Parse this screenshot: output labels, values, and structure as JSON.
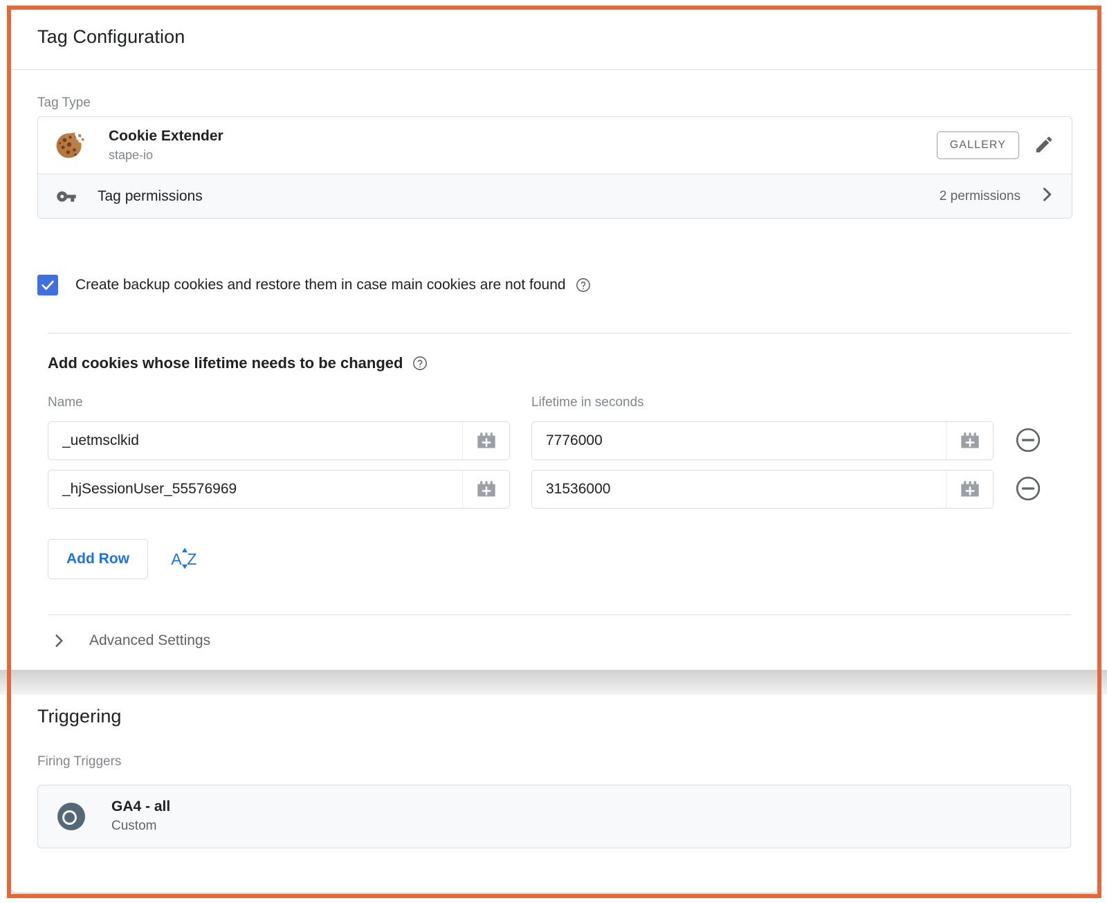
{
  "highlight": {
    "color": "#e2693a"
  },
  "tag_configuration": {
    "title": "Tag Configuration",
    "tag_type_label": "Tag Type",
    "tag_type": {
      "icon": "cookie-icon",
      "name": "Cookie Extender",
      "vendor": "stape-io",
      "gallery_button": "GALLERY",
      "edit_icon": "pencil-icon"
    },
    "tag_permissions": {
      "icon": "key-icon",
      "label": "Tag permissions",
      "count": "2 permissions",
      "chevron": "chevron-right-icon"
    },
    "backup_cookies": {
      "checked": true,
      "label": "Create backup cookies and restore them in case main cookies are not found",
      "help_icon": "help-circle-icon"
    },
    "cookies_section": {
      "title": "Add cookies whose lifetime needs to be changed",
      "help_icon": "help-circle-icon",
      "columns": [
        "Name",
        "Lifetime in seconds"
      ],
      "rows": [
        {
          "name": "_uetmsclkid",
          "lifetime": "7776000"
        },
        {
          "name": "_hjSessionUser_55576969",
          "lifetime": "31536000"
        }
      ],
      "variable_picker_icon": "lego-block-plus-icon",
      "remove_row_icon": "minus-circle-icon",
      "add_row_button": "Add Row",
      "sort_icon": "sort-alpha-az-icon"
    },
    "advanced_settings": {
      "chevron": "chevron-right-icon",
      "label": "Advanced Settings"
    }
  },
  "triggering": {
    "title": "Triggering",
    "firing_triggers_label": "Firing Triggers",
    "triggers": [
      {
        "icon": "trigger-circle-icon",
        "name": "GA4 - all",
        "type": "Custom"
      }
    ]
  }
}
